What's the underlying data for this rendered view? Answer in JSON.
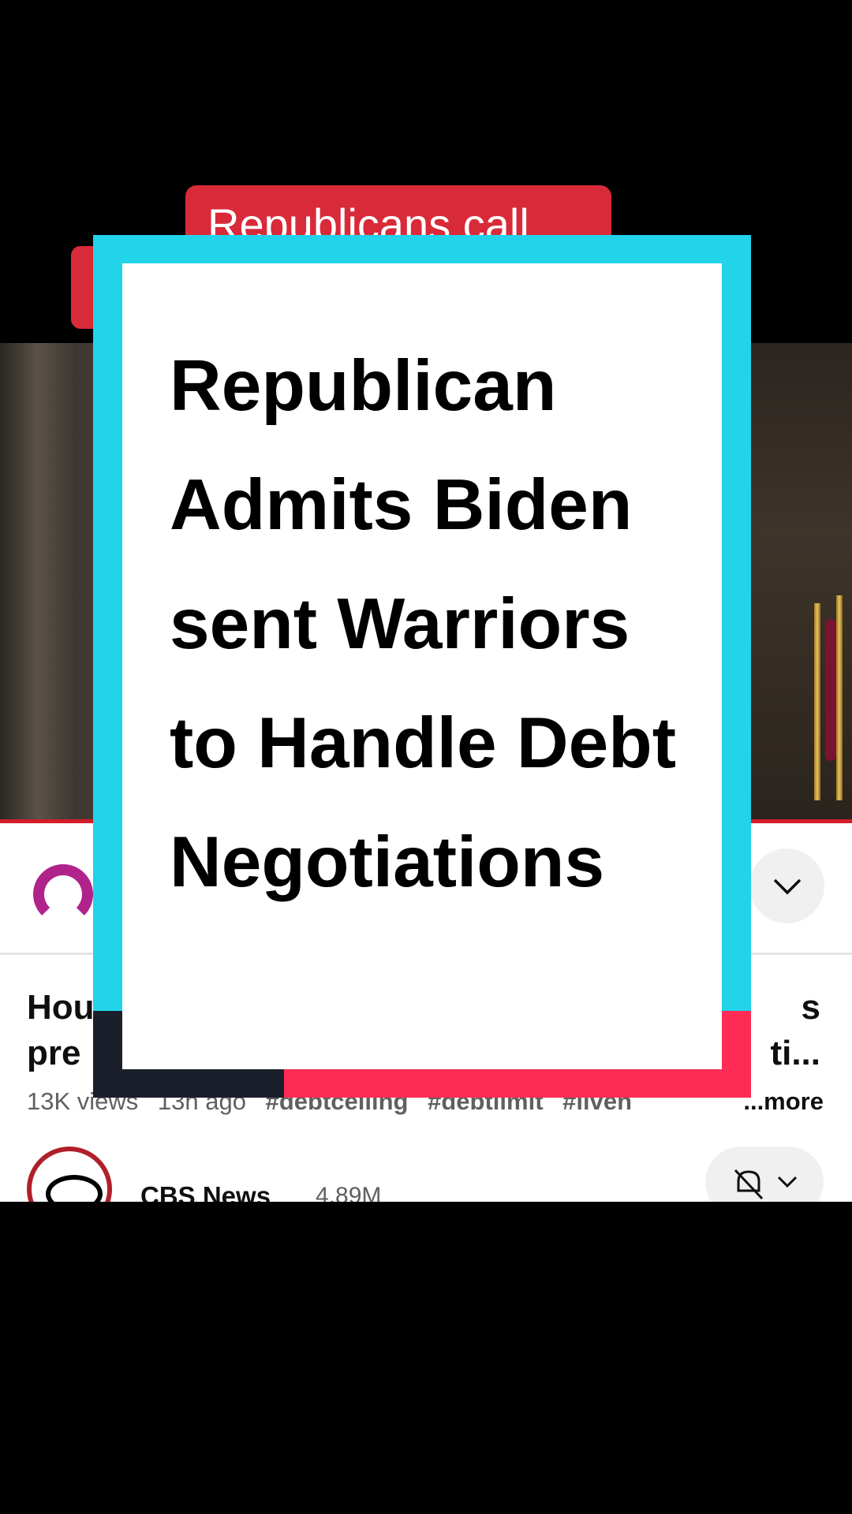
{
  "video": {
    "lower_third_text": "Republicans call"
  },
  "info_panel": {
    "title_left": "Hou\npre",
    "title_right": "s\nti...",
    "views": "13K views",
    "age": "13h ago",
    "hashtags": [
      "#debtceiling",
      "#debtlimit",
      "#liven"
    ],
    "more_label": "...more",
    "channel_name": "CBS News",
    "subscribers": "4.89M"
  },
  "overlay_card": {
    "headline": "Republican Admits Biden sent Warriors to Handle Debt Negotiations"
  },
  "colors": {
    "card_border": "#22d3ea",
    "card_accent_red": "#fe2c55",
    "card_accent_dark": "#1b1f2b",
    "news_red": "#d92a3a"
  },
  "icons": [
    "chevron-down-icon",
    "bell-muted-icon",
    "cbs-eye-logo"
  ]
}
